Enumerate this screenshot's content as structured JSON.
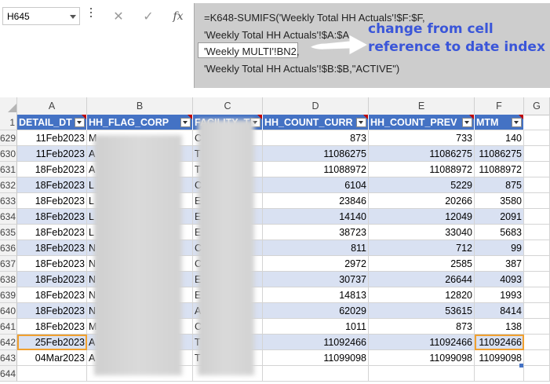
{
  "name_box": {
    "value": "H645"
  },
  "formula_bar": {
    "cancel_icon": "x-icon",
    "enter_icon": "check-icon",
    "fx_label": "fx",
    "lines": [
      "=K648-SUMIFS('Weekly Total HH Actuals'!$F:$F,",
      "'Weekly Total HH Actuals'!$A:$A,",
      "'Weekly MULTI'!BN2,",
      "'Weekly Total HH Actuals'!$B:$B,\"ACTIVE\")"
    ],
    "annotation_line1": "change from cell",
    "annotation_line2": "reference to date index",
    "annotation_color": "#3a56d9"
  },
  "columns": [
    "A",
    "B",
    "C",
    "D",
    "E",
    "F",
    "G"
  ],
  "header_row": {
    "number": "1",
    "cells": [
      "DETAIL_DT",
      "HH_FLAG_CORP",
      "FACILITY_TY",
      "HH_COUNT_CURR",
      "HH_COUNT_PREV",
      "MTM"
    ]
  },
  "rows": [
    {
      "num": "629",
      "a": "11Feb2023",
      "b": "M",
      "c": "C",
      "d": "873",
      "e": "733",
      "f": "140"
    },
    {
      "num": "630",
      "a": "11Feb2023",
      "b": "A",
      "c": "T",
      "d": "11086275",
      "e": "11086275",
      "f": "11086275"
    },
    {
      "num": "631",
      "a": "18Feb2023",
      "b": "A",
      "c": "T",
      "d": "11088972",
      "e": "11088972",
      "f": "11088972"
    },
    {
      "num": "632",
      "a": "18Feb2023",
      "b": "L",
      "c": "C",
      "d": "6104",
      "e": "5229",
      "f": "875"
    },
    {
      "num": "633",
      "a": "18Feb2023",
      "b": "L",
      "c": "E",
      "d": "23846",
      "e": "20266",
      "f": "3580"
    },
    {
      "num": "634",
      "a": "18Feb2023",
      "b": "L",
      "c": "E",
      "d": "14140",
      "e": "12049",
      "f": "2091"
    },
    {
      "num": "635",
      "a": "18Feb2023",
      "b": "L",
      "c": "E",
      "d": "38723",
      "e": "33040",
      "f": "5683"
    },
    {
      "num": "636",
      "a": "18Feb2023",
      "b": "N",
      "c": "C",
      "d": "811",
      "e": "712",
      "f": "99"
    },
    {
      "num": "637",
      "a": "18Feb2023",
      "b": "N",
      "c": "C",
      "d": "2972",
      "e": "2585",
      "f": "387"
    },
    {
      "num": "638",
      "a": "18Feb2023",
      "b": "N",
      "c": "E",
      "d": "30737",
      "e": "26644",
      "f": "4093"
    },
    {
      "num": "639",
      "a": "18Feb2023",
      "b": "N",
      "c": "E",
      "d": "14813",
      "e": "12820",
      "f": "1993"
    },
    {
      "num": "640",
      "a": "18Feb2023",
      "b": "N",
      "c": "A",
      "d": "62029",
      "e": "53615",
      "f": "8414"
    },
    {
      "num": "641",
      "a": "18Feb2023",
      "b": "M",
      "c": "C",
      "d": "1011",
      "e": "873",
      "f": "138"
    },
    {
      "num": "642",
      "a": "25Feb2023",
      "b": "A",
      "c": "T",
      "d": "11092466",
      "e": "11092466",
      "f": "11092466"
    },
    {
      "num": "643",
      "a": "04Mar2023",
      "b": "A",
      "c": "T",
      "d": "11099098",
      "e": "11099098",
      "f": "11099098"
    },
    {
      "num": "644",
      "a": "",
      "b": "",
      "c": "",
      "d": "",
      "e": "",
      "f": ""
    }
  ],
  "colors": {
    "header_fill": "#4472c4",
    "band_fill": "#d9e1f2",
    "highlight_outline": "#f0a030"
  }
}
